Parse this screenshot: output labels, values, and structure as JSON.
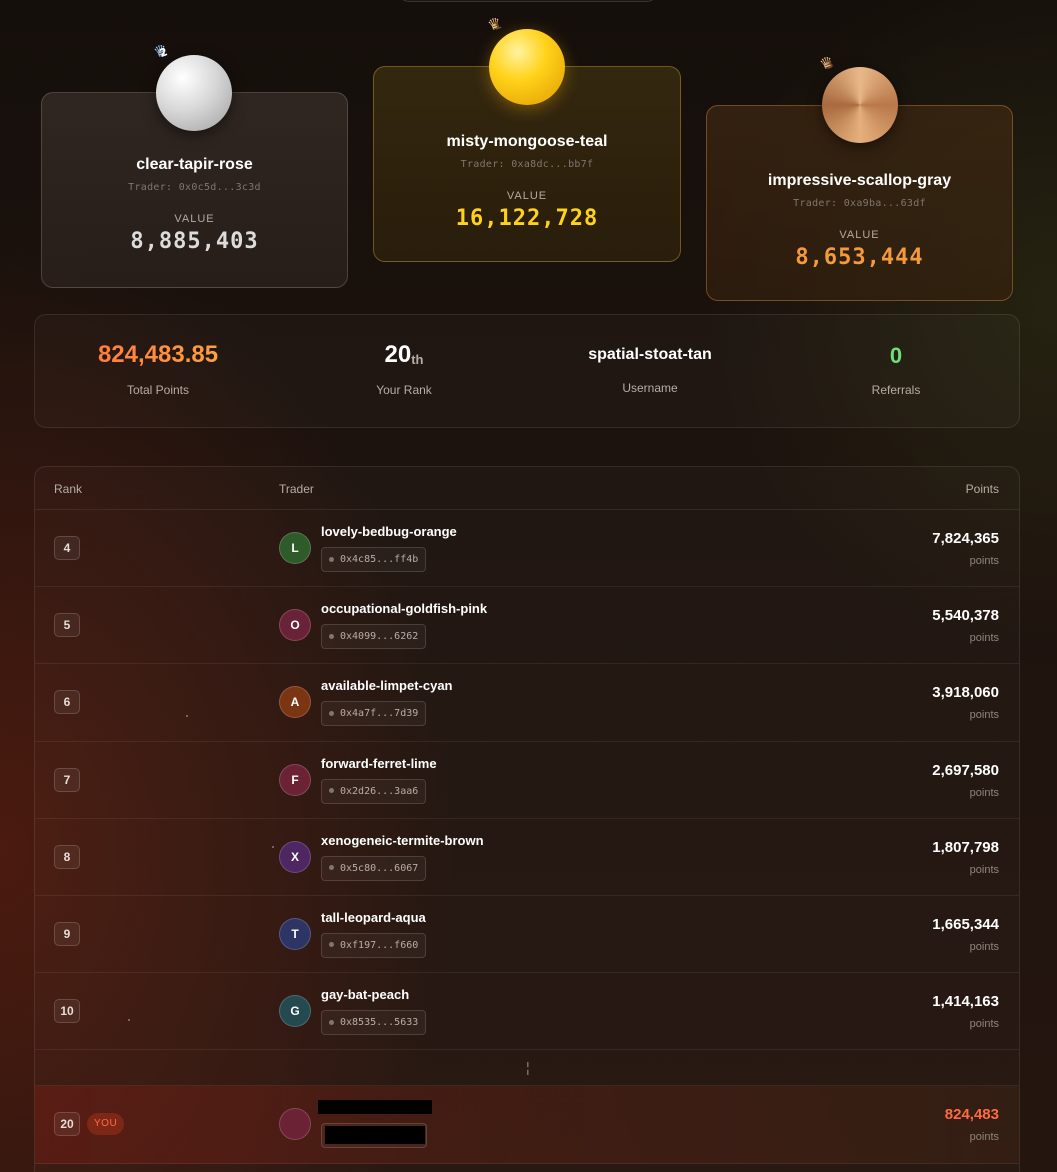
{
  "podium": {
    "second": {
      "place": "2",
      "name": "clear-tapir-rose",
      "trader": "Trader: 0x0c5d...3c3d",
      "value_label": "VALUE",
      "value": "8,885,403"
    },
    "first": {
      "place": "1",
      "name": "misty-mongoose-teal",
      "trader": "Trader: 0xa8dc...bb7f",
      "value_label": "VALUE",
      "value": "16,122,728"
    },
    "third": {
      "place": "3",
      "name": "impressive-scallop-gray",
      "trader": "Trader: 0xa9ba...63df",
      "value_label": "VALUE",
      "value": "8,653,444"
    }
  },
  "stats": {
    "total_points": "824,483.85",
    "total_points_label": "Total Points",
    "rank": "20",
    "rank_suffix": "th",
    "rank_label": "Your Rank",
    "username": "spatial-stoat-tan",
    "username_label": "Username",
    "referrals": "0",
    "referrals_label": "Referrals"
  },
  "table": {
    "headers": {
      "rank": "Rank",
      "trader": "Trader",
      "points": "Points"
    },
    "rows": [
      {
        "rank": "4",
        "initial": "L",
        "name": "lovely-bedbug-orange",
        "address": "0x4c85...ff4b",
        "points": "7,824,365",
        "points_unit": "points",
        "avatar_color": "#2f5a2a"
      },
      {
        "rank": "5",
        "initial": "O",
        "name": "occupational-goldfish-pink",
        "address": "0x4099...6262",
        "points": "5,540,378",
        "points_unit": "points",
        "avatar_color": "#6a2238"
      },
      {
        "rank": "6",
        "initial": "A",
        "name": "available-limpet-cyan",
        "address": "0x4a7f...7d39",
        "points": "3,918,060",
        "points_unit": "points",
        "avatar_color": "#7a3512"
      },
      {
        "rank": "7",
        "initial": "F",
        "name": "forward-ferret-lime",
        "address": "0x2d26...3aa6",
        "points": "2,697,580",
        "points_unit": "points",
        "avatar_color": "#6a2234"
      },
      {
        "rank": "8",
        "initial": "X",
        "name": "xenogeneic-termite-brown",
        "address": "0x5c80...6067",
        "points": "1,807,798",
        "points_unit": "points",
        "avatar_color": "#4e2662"
      },
      {
        "rank": "9",
        "initial": "T",
        "name": "tall-leopard-aqua",
        "address": "0xf197...f660",
        "points": "1,665,344",
        "points_unit": "points",
        "avatar_color": "#2e3564"
      },
      {
        "rank": "10",
        "initial": "G",
        "name": "gay-bat-peach",
        "address": "0x8535...5633",
        "points": "1,414,163",
        "points_unit": "points",
        "avatar_color": "#244a50"
      }
    ],
    "gap_symbol": "¦",
    "you_row": {
      "rank": "20",
      "badge": "YOU",
      "points": "824,483",
      "points_unit": "points",
      "avatar_color": "#6a2234"
    }
  },
  "icons": {
    "crown": "crown-icon",
    "medal": "medal-icon",
    "address_dot": "dot-icon"
  },
  "colors": {
    "gold": "#ffd21a",
    "silver": "#dcdcdc",
    "bronze": "#f59a3c",
    "accent": "#ff6a45",
    "referrals": "#6ee07a"
  }
}
